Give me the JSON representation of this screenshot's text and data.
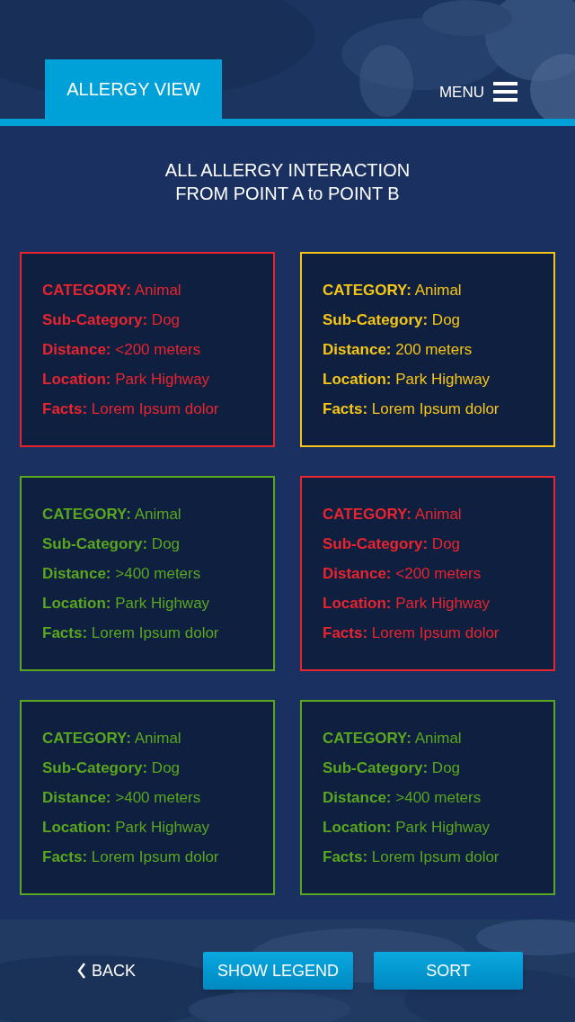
{
  "header": {
    "tab": {
      "label": "ALLERGY VIEW",
      "selected": true
    },
    "menu_label": "MENU"
  },
  "title_lines": [
    "ALL ALLERGY INTERACTION",
    "FROM POINT A to POINT B"
  ],
  "cards": [
    {
      "color": "#e8252e",
      "fields": [
        "**CATEGORY:** Animal",
        "**Sub-Category:** Dog",
        "**Distance:** <200 meters",
        "**Location:** Park Highway",
        "**Facts:** Lorem Ipsum dolor"
      ]
    },
    {
      "color": "#f5c518",
      "fields": [
        "**CATEGORY:** Animal",
        "**Sub-Category:** Dog",
        "**Distance:** 200 meters",
        "**Location:** Park Highway",
        "**Facts:** Lorem Ipsum dolor"
      ]
    },
    {
      "color": "#5aa61e",
      "fields": [
        "**CATEGORY:** Animal",
        "**Sub-Category:** Dog",
        "**Distance:** >400 meters",
        "**Location:** Park Highway",
        "**Facts:** Lorem Ipsum dolor"
      ]
    },
    {
      "color": "#e8252e",
      "fields": [
        "**CATEGORY:** Animal",
        "**Sub-Category:** Dog",
        "**Distance:** <200 meters",
        "**Location:** Park Highway",
        "**Facts:** Lorem Ipsum dolor"
      ]
    },
    {
      "color": "#5aa61e",
      "fields": [
        "**CATEGORY:** Animal",
        "**Sub-Category:** Dog",
        "**Distance:** >400 meters",
        "**Location:** Park Highway",
        "**Facts:** Lorem Ipsum dolor"
      ]
    },
    {
      "color": "#5aa61e",
      "fields": [
        "**CATEGORY:** Animal",
        "**Sub-Category:** Dog",
        "**Distance:** >400 meters",
        "**Location:** Park Highway",
        "**Facts:** Lorem Ipsum dolor"
      ]
    }
  ],
  "footer": {
    "back": "BACK",
    "buttons": [
      "SHOW LEGEND",
      "SORT"
    ]
  }
}
